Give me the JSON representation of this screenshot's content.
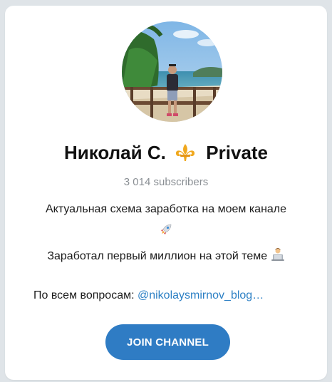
{
  "channel": {
    "name": "Николай С.",
    "suffix": "Private",
    "title_emoji": "fleur-de-lis-icon",
    "subscribers": "3 014 subscribers",
    "description_line1": "Актуальная схема заработка на моем канале",
    "description_emoji1": "rocket-icon",
    "description_line2": "Заработал первый миллион на этой теме",
    "description_emoji2": "laptop-person-icon",
    "contact_prefix": "По всем вопросам: ",
    "contact_link": "@nikolaysmirnov_blog…"
  },
  "join_button": {
    "label": "JOIN CHANNEL"
  },
  "colors": {
    "accent": "#2f7cc4",
    "link": "#2b7fc4",
    "muted": "#8a8f94",
    "background": "#dfe4e8",
    "card": "#ffffff"
  }
}
